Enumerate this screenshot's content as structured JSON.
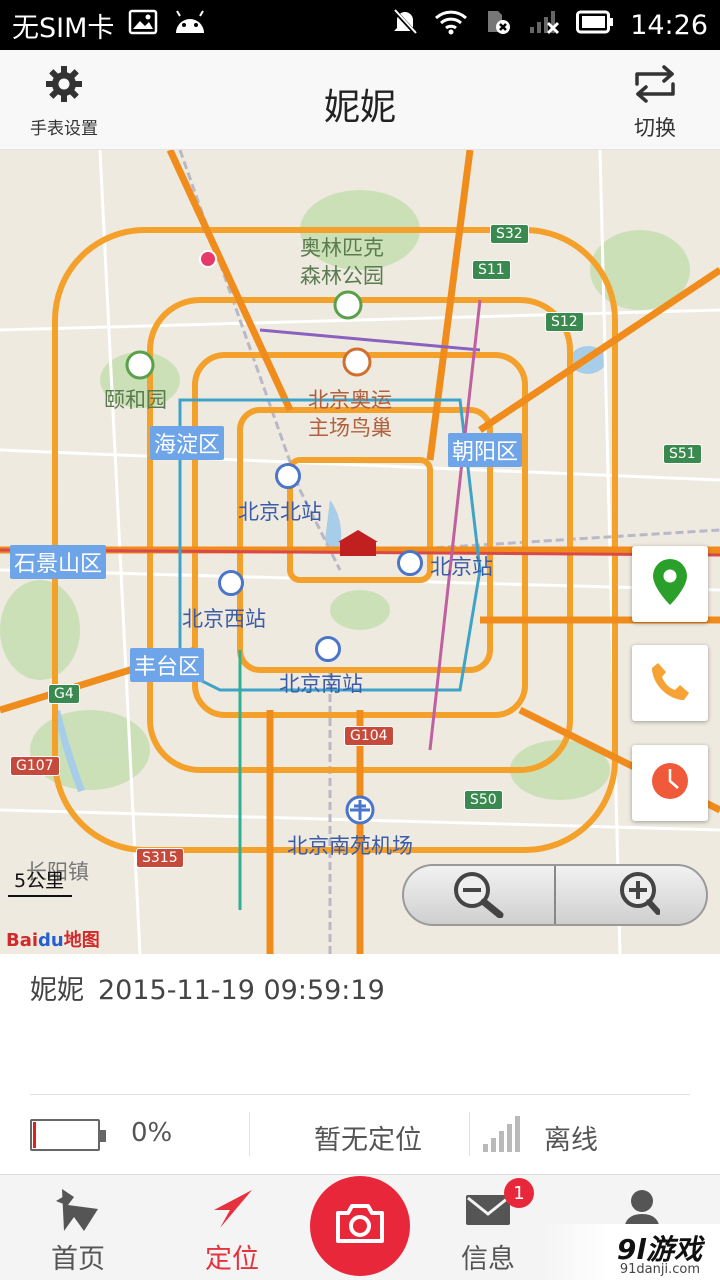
{
  "status_bar": {
    "carrier": "无SIM卡",
    "time": "14:26",
    "icons": [
      "image-icon",
      "android-icon",
      "mute-icon",
      "wifi-icon",
      "sim-off-icon",
      "signal-off-icon",
      "battery-icon"
    ]
  },
  "header": {
    "title": "妮妮",
    "settings_label": "手表设置",
    "switch_label": "切换"
  },
  "map": {
    "places": [
      "奥林匹克",
      "森林公园",
      "颐和园",
      "北京奥运",
      "主场鸟巢",
      "北京北站",
      "北京站",
      "北京西站",
      "北京南站",
      "北京南苑机场",
      "长阳镇"
    ],
    "districts": [
      "海淀区",
      "朝阳区",
      "石景山区",
      "丰台区"
    ],
    "highways": [
      "S32",
      "S11",
      "S12",
      "S51",
      "G4",
      "G107",
      "G104",
      "S50",
      "S315"
    ],
    "scale": "5公里",
    "logo_bai": "Bai",
    "logo_du": "du",
    "logo_map": "地图",
    "side_buttons": [
      "location-pin-icon",
      "phone-icon",
      "clock-icon"
    ]
  },
  "info": {
    "name": "妮妮",
    "timestamp": "2015-11-19 09:59:19",
    "battery_percent": "0%",
    "battery_level": 0,
    "location_status": "暂无定位",
    "connection_status": "离线"
  },
  "tabs": [
    {
      "label": "首页",
      "icon": "home-origami-icon",
      "active": false
    },
    {
      "label": "定位",
      "icon": "navigation-arrow-icon",
      "active": true
    },
    {
      "label": "",
      "icon": "camera-icon",
      "active": false
    },
    {
      "label": "信息",
      "icon": "mail-icon",
      "active": false,
      "badge": "1"
    },
    {
      "label": "",
      "icon": "user-icon",
      "active": false
    }
  ],
  "watermark": {
    "main": "9l游戏",
    "sub": "91danji.com"
  },
  "colors": {
    "accent": "#e8283a",
    "header_bg": "#f8f8f8",
    "map_bg": "#efeae0",
    "district_bg": "#6ea4e8",
    "road": "#f4a12b"
  }
}
